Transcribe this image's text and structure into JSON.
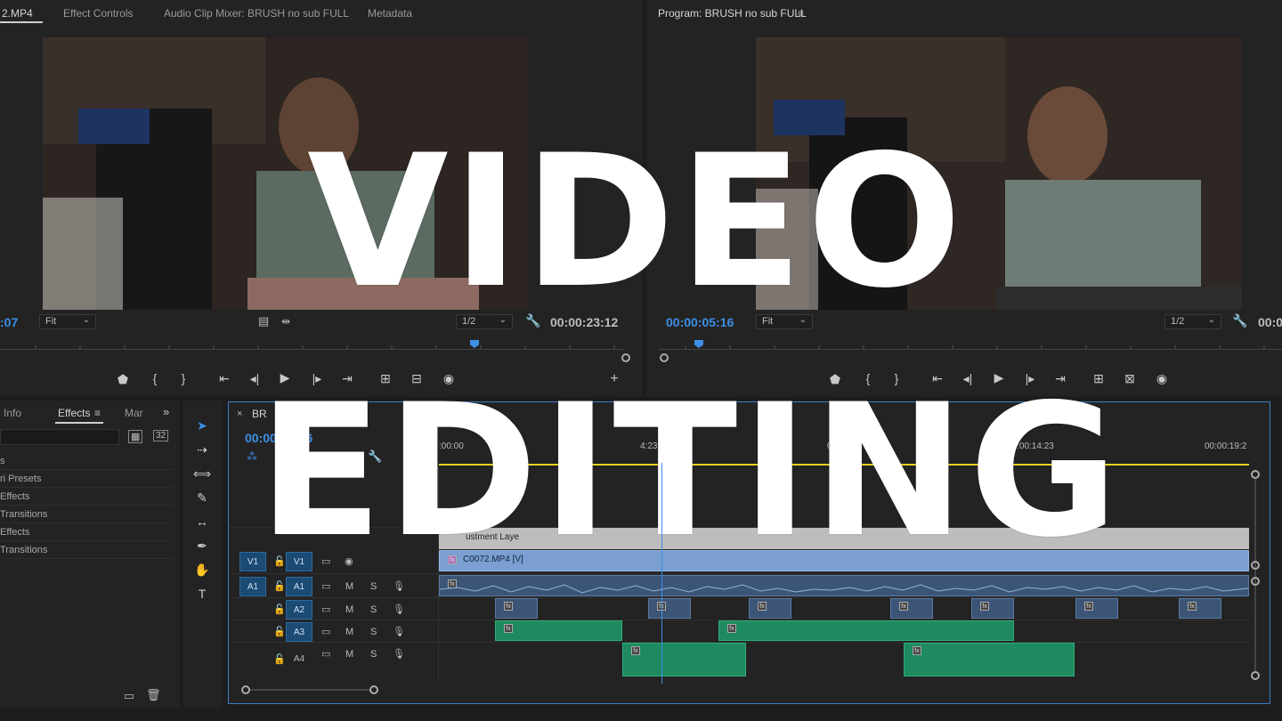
{
  "source_monitor": {
    "tabs": [
      {
        "label": "2.MP4",
        "active": true
      },
      {
        "label": "Effect Controls",
        "active": false
      },
      {
        "label": "Audio Clip Mixer: BRUSH no sub FULL",
        "active": false
      },
      {
        "label": "Metadata",
        "active": false
      }
    ],
    "timecode_left": ":07",
    "fit_label": "Fit",
    "resolution": "1/2",
    "timecode_right": "00:00:23:12"
  },
  "program_monitor": {
    "title": "Program: BRUSH no sub FULL",
    "menu_icon": "hamburger-icon",
    "timecode_left": "00:00:05:16",
    "fit_label": "Fit",
    "resolution": "1/2",
    "timecode_right": "00:0"
  },
  "effects_panel": {
    "tabs": [
      "Info",
      "Effects",
      "Mar"
    ],
    "active_tab": "Effects",
    "badge_a": "32",
    "items": [
      "s",
      "ri Presets",
      "Effects",
      "Transitions",
      "Effects",
      "Transitions"
    ]
  },
  "timeline": {
    "sequence_tab": "BR",
    "timecode": "00:00:05:16",
    "ruler_labels": [
      ":00:00",
      "4:23",
      "0:09",
      "00:00:14:23",
      "00:00:19:2"
    ],
    "tracks": {
      "v1_source": "V1",
      "v1_target": "V1",
      "a1_source": "A1",
      "a1_target": "A1",
      "a2": "A2",
      "a3": "A3",
      "a4": "A4",
      "mute": "M",
      "solo": "S"
    },
    "clip_adjustment": "ustment Laye",
    "clip_video": "C0072.MP4 [V]",
    "fx_label": "fx"
  },
  "overlay": {
    "line1": "VIDEO",
    "line2": "EDITING"
  },
  "colors": {
    "accent_blue": "#3d8fe6",
    "track_green": "#1f8a5f",
    "audio_blue": "#3c5577",
    "video_clip": "#7a9fd0",
    "work_area_yellow": "#e6d21e"
  }
}
